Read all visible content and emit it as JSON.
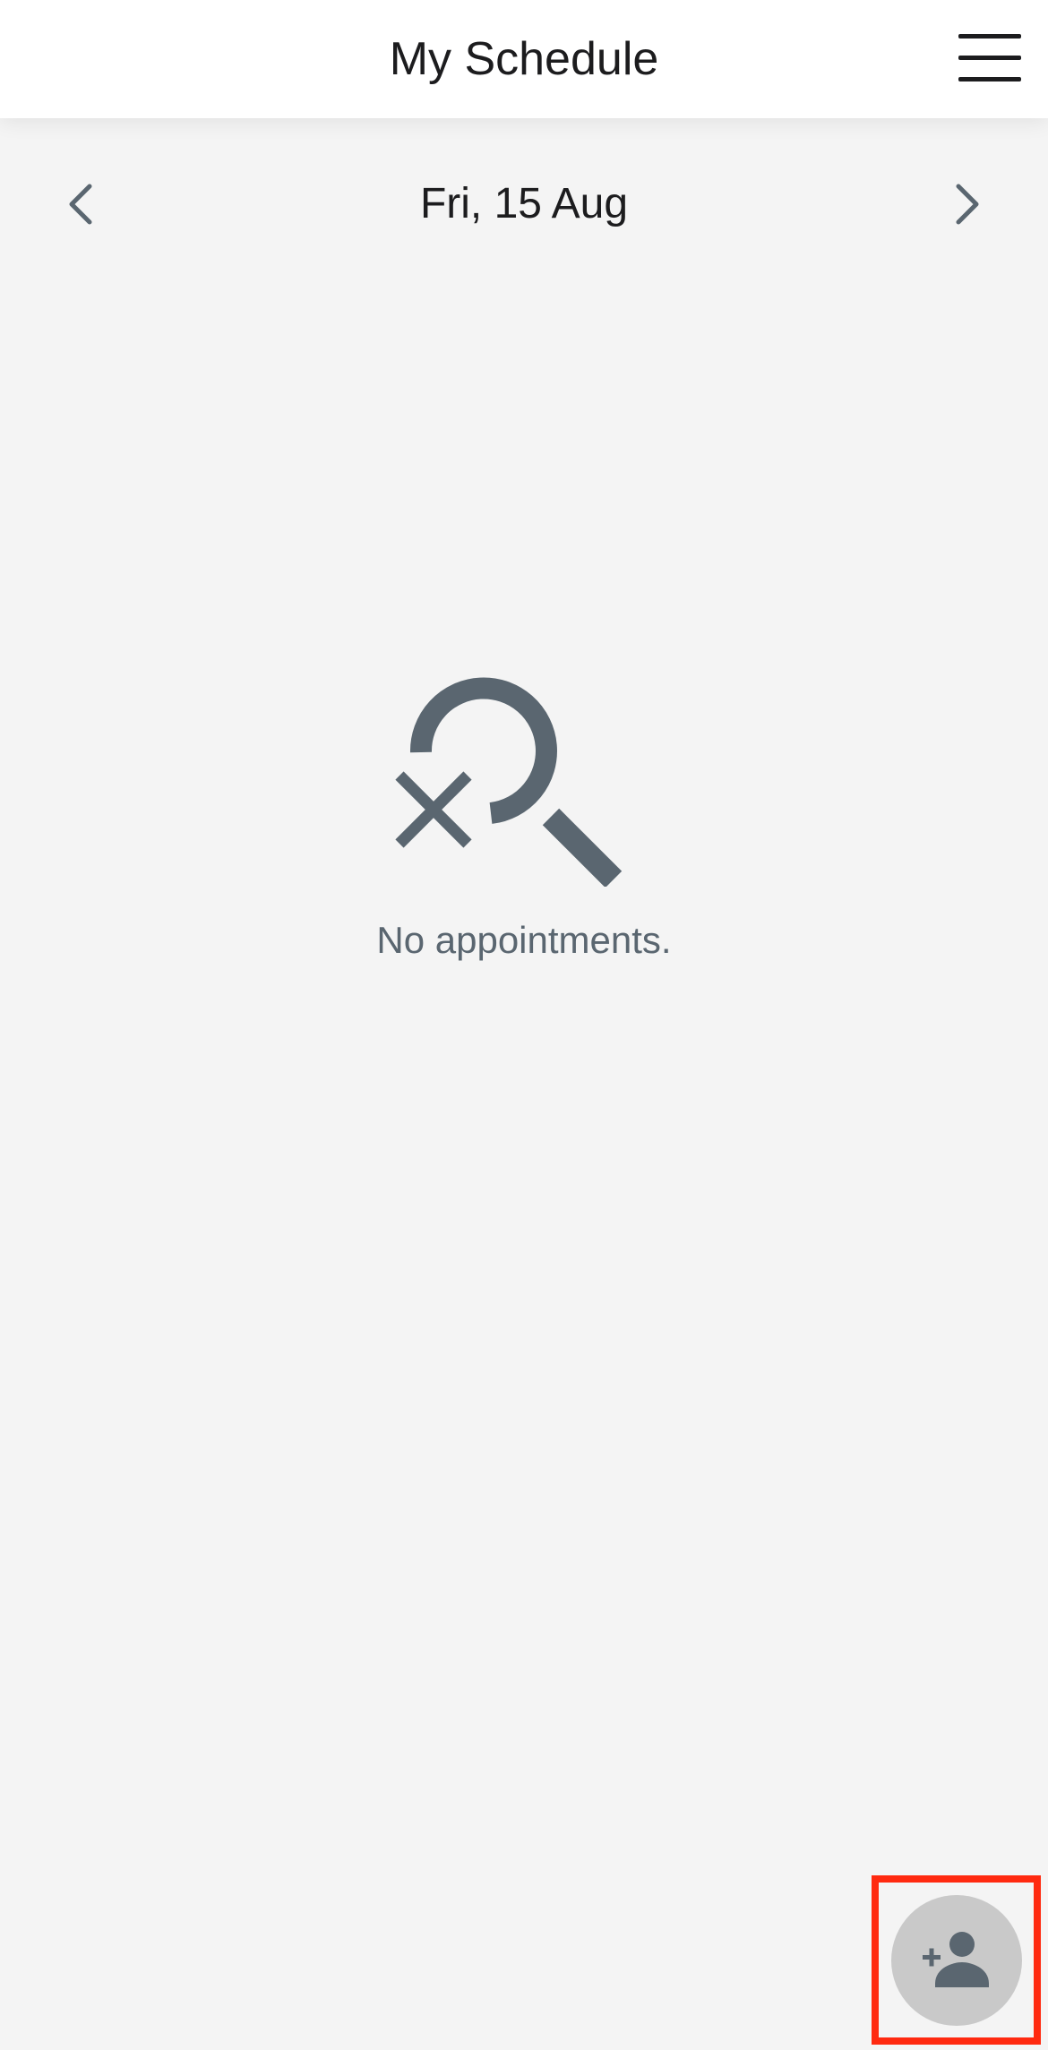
{
  "header": {
    "title": "My Schedule",
    "menu_icon": "hamburger-menu-icon"
  },
  "date_nav": {
    "current_date": "Fri, 15 Aug",
    "prev_icon": "chevron-left-icon",
    "next_icon": "chevron-right-icon"
  },
  "empty_state": {
    "icon": "search-off-icon",
    "message": "No appointments."
  },
  "fab": {
    "icon": "add-person-icon"
  },
  "colors": {
    "background": "#f4f4f4",
    "header_bg": "#ffffff",
    "icon_gray": "#5a6670",
    "fab_bg": "#c9c9c9",
    "highlight": "#ff2a10",
    "text_dark": "#1c1c1e"
  }
}
